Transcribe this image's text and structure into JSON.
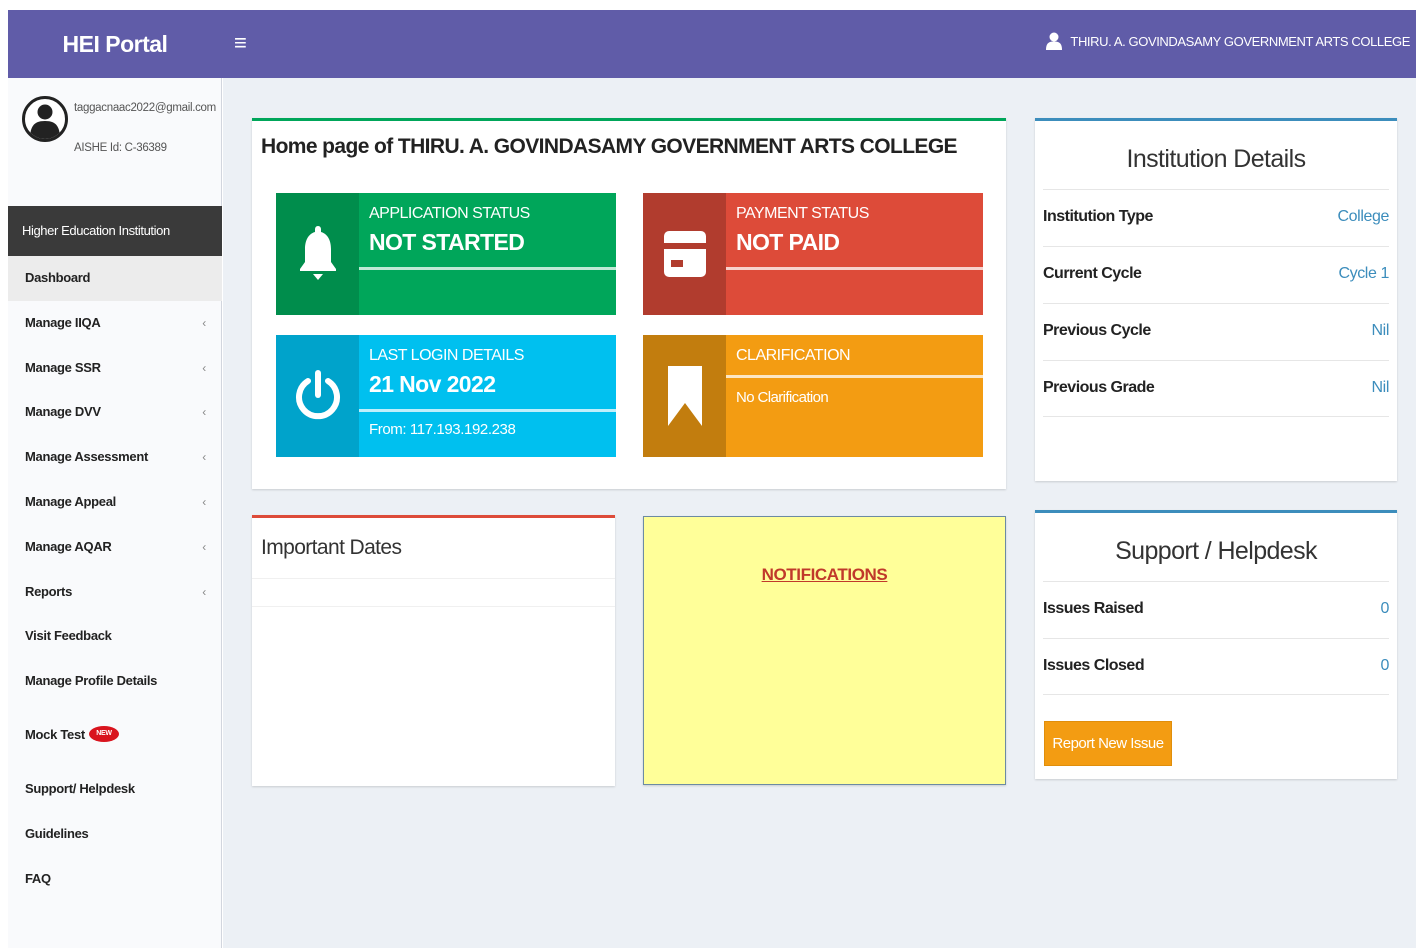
{
  "app": {
    "title": "HEI Portal"
  },
  "header": {
    "user_label": "THIRU. A. GOVINDASAMY GOVERNMENT ARTS COLLEGE",
    "menu_toggle": "≡"
  },
  "user": {
    "email": "taggacnaac2022@gmail.com",
    "aishe": "AISHE Id: C-36389"
  },
  "sidebar": {
    "header": "Higher Education Institution",
    "items": [
      {
        "label": "Dashboard",
        "chevron": ""
      },
      {
        "label": "Manage IIQA",
        "chevron": "‹"
      },
      {
        "label": "Manage SSR",
        "chevron": "‹"
      },
      {
        "label": "Manage DVV",
        "chevron": "‹"
      },
      {
        "label": "Manage Assessment",
        "chevron": "‹"
      },
      {
        "label": "Manage Appeal",
        "chevron": "‹"
      },
      {
        "label": "Manage AQAR",
        "chevron": "‹"
      },
      {
        "label": "Reports",
        "chevron": "‹"
      },
      {
        "label": "Visit Feedback",
        "chevron": ""
      },
      {
        "label": "Manage Profile Details",
        "chevron": ""
      },
      {
        "label": "Mock Test",
        "chevron": ""
      },
      {
        "label": "Support/ Helpdesk",
        "chevron": ""
      },
      {
        "label": "Guidelines",
        "chevron": ""
      },
      {
        "label": "FAQ",
        "chevron": ""
      }
    ],
    "new_badge": "NEW"
  },
  "home": {
    "title": "Home page of THIRU. A. GOVINDASAMY GOVERNMENT ARTS COLLEGE",
    "application": {
      "label": "APPLICATION STATUS",
      "value": "NOT STARTED"
    },
    "payment": {
      "label": "PAYMENT STATUS",
      "value": "NOT PAID"
    },
    "login": {
      "label": "LAST LOGIN DETAILS",
      "value": "21 Nov 2022",
      "desc": "From: 117.193.192.238"
    },
    "clarification": {
      "label": "CLARIFICATION",
      "value": "No Clarification"
    }
  },
  "dates": {
    "title": "Important Dates"
  },
  "notifications": {
    "link": "NOTIFICATIONS"
  },
  "institution": {
    "title": "Institution Details",
    "rows": [
      {
        "label": "Institution Type",
        "value": "College"
      },
      {
        "label": "Current Cycle",
        "value": "Cycle 1"
      },
      {
        "label": "Previous Cycle",
        "value": "Nil"
      },
      {
        "label": "Previous Grade",
        "value": "Nil"
      }
    ]
  },
  "support": {
    "title": "Support / Helpdesk",
    "rows": [
      {
        "label": "Issues Raised",
        "value": "0"
      },
      {
        "label": "Issues Closed",
        "value": "0"
      }
    ],
    "button": "Report New Issue"
  },
  "colors": {
    "header": "#605ca8",
    "green": "#00a65a",
    "red": "#dd4b39",
    "aqua": "#00c0ef",
    "orange": "#f39c12",
    "blue": "#3c8dbc"
  }
}
